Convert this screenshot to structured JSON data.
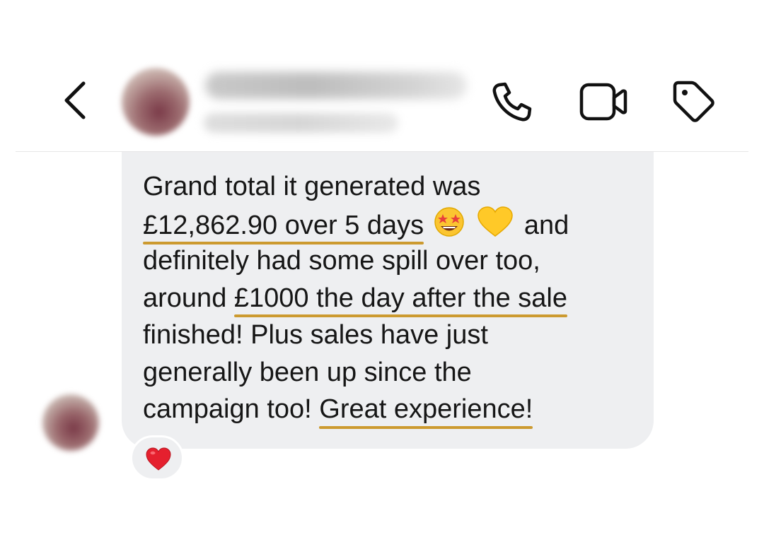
{
  "header": {
    "back_icon": "chevron-left-icon",
    "actions": [
      {
        "icon": "phone-icon"
      },
      {
        "icon": "video-camera-icon"
      },
      {
        "icon": "tag-icon"
      }
    ]
  },
  "message": {
    "lines": [
      {
        "plain_before": "Grand total it generated was",
        "highlight": "",
        "plain_after": ""
      },
      {
        "plain_before": "",
        "highlight": "£12,862.90 over 5 days",
        "plain_after": "and"
      },
      {
        "plain_before": "definitely had some spill over too,",
        "highlight": "",
        "plain_after": ""
      },
      {
        "plain_before": "around ",
        "highlight": "£1000 the day after the sale",
        "plain_after": ""
      },
      {
        "plain_before": "finished! Plus sales have just",
        "highlight": "",
        "plain_after": ""
      },
      {
        "plain_before": "generally been up since the",
        "highlight": "",
        "plain_after": ""
      },
      {
        "plain_before": "campaign too! ",
        "highlight": "Great experience!",
        "plain_after": ""
      }
    ],
    "emojis": [
      "star-struck-emoji",
      "yellow-heart-emoji"
    ],
    "reaction": "red-heart-emoji",
    "underline_color": "#cc9a2f",
    "bubble_color": "#eeeff1"
  }
}
